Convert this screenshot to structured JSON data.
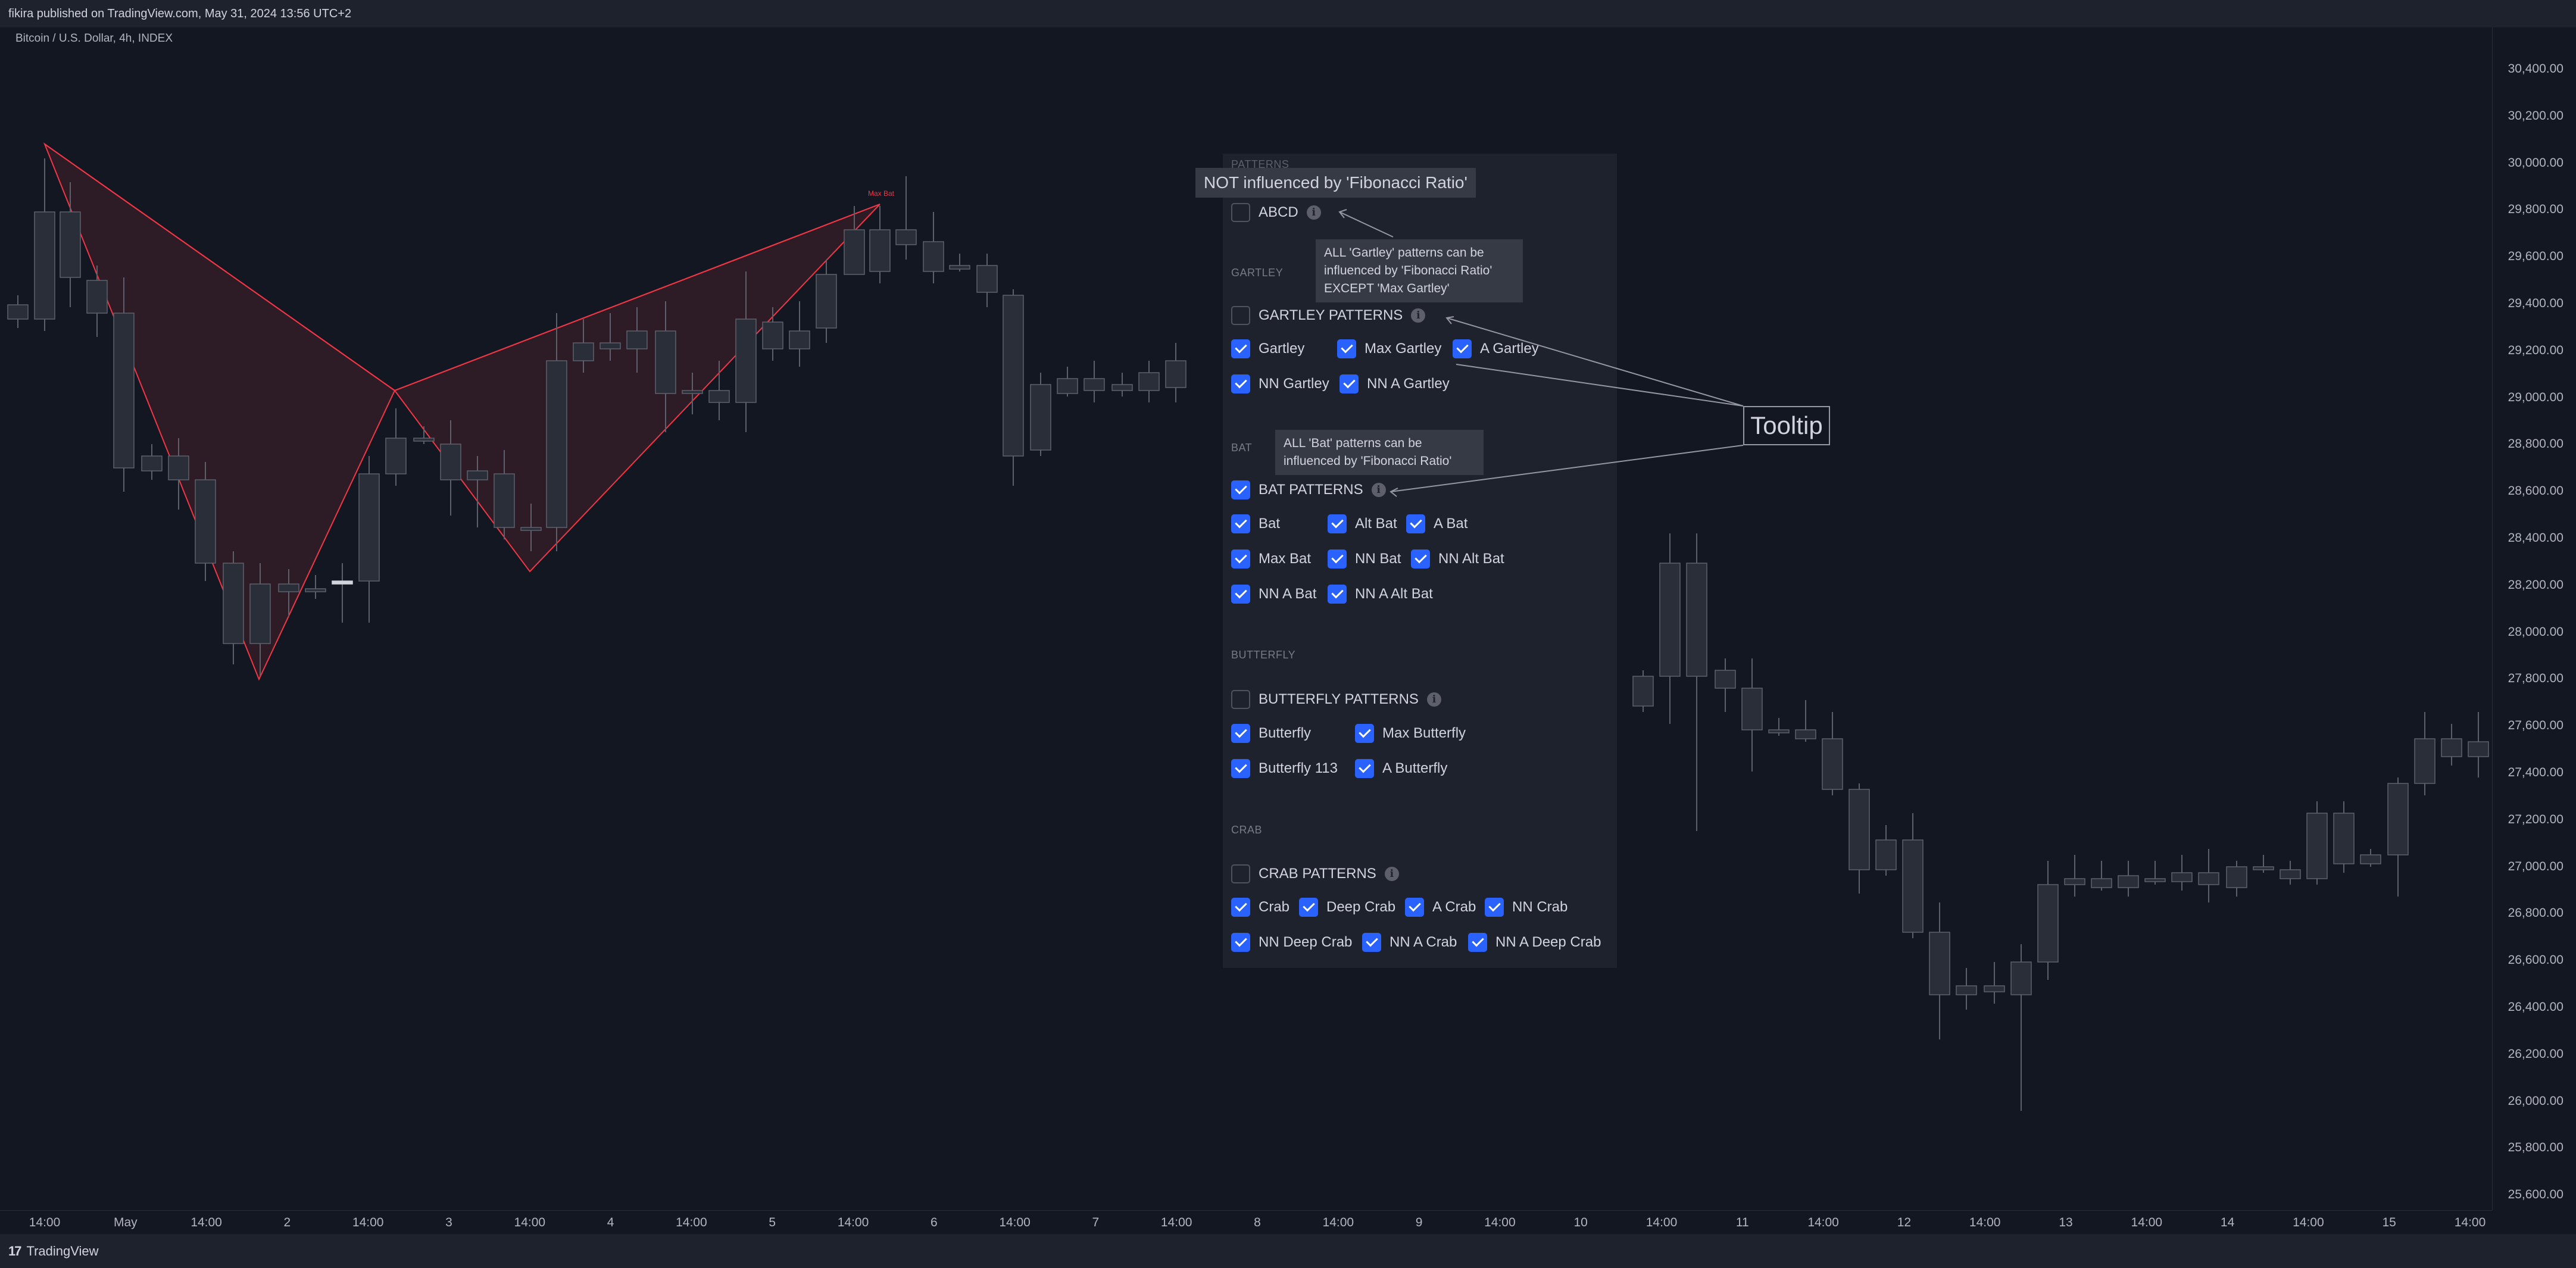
{
  "header": {
    "published": "fikira published on TradingView.com, May 31, 2024 13:56 UTC+2"
  },
  "chart": {
    "symbol": "Bitcoin / U.S. Dollar, 4h, INDEX",
    "pattern_label": "Max Bat",
    "price_axis": [
      "30,400.00",
      "30,200.00",
      "30,000.00",
      "29,800.00",
      "29,600.00",
      "29,400.00",
      "29,200.00",
      "29,000.00",
      "28,800.00",
      "28,600.00",
      "28,400.00",
      "28,200.00",
      "28,000.00",
      "27,800.00",
      "27,600.00",
      "27,400.00",
      "27,200.00",
      "27,000.00",
      "26,800.00",
      "26,600.00",
      "26,400.00",
      "26,200.00",
      "26,000.00",
      "25,800.00",
      "25,600.00"
    ],
    "time_axis": [
      "14:00",
      "May",
      "14:00",
      "2",
      "14:00",
      "3",
      "14:00",
      "4",
      "14:00",
      "5",
      "14:00",
      "6",
      "14:00",
      "7",
      "14:00",
      "8",
      "14:00",
      "9",
      "14:00",
      "10",
      "14:00",
      "11",
      "14:00",
      "12",
      "14:00",
      "13",
      "14:00",
      "14",
      "14:00",
      "15",
      "14:00"
    ],
    "colors": {
      "bull": "#d1d4dc",
      "bear": "#2a2e39",
      "wick": "#5d606b",
      "pattern": "#f23645"
    }
  },
  "panel": {
    "partial_header": "PATTERNS",
    "abcd": {
      "label": "ABCD",
      "checked": false
    },
    "gartley": {
      "section": "GARTLEY",
      "header": {
        "label": "GARTLEY PATTERNS",
        "checked": false
      },
      "options": [
        {
          "label": "Gartley",
          "checked": true
        },
        {
          "label": "Max Gartley",
          "checked": true
        },
        {
          "label": "A Gartley",
          "checked": true
        },
        {
          "label": "NN Gartley",
          "checked": true
        },
        {
          "label": "NN A Gartley",
          "checked": true
        }
      ]
    },
    "bat": {
      "section": "BAT",
      "header": {
        "label": "BAT PATTERNS",
        "checked": true
      },
      "options": [
        {
          "label": "Bat",
          "checked": true
        },
        {
          "label": "Alt Bat",
          "checked": true
        },
        {
          "label": "A Bat",
          "checked": true
        },
        {
          "label": "Max Bat",
          "checked": true
        },
        {
          "label": "NN Bat",
          "checked": true
        },
        {
          "label": "NN Alt Bat",
          "checked": true
        },
        {
          "label": "NN A Bat",
          "checked": true
        },
        {
          "label": "NN A Alt Bat",
          "checked": true
        }
      ]
    },
    "butterfly": {
      "section": "BUTTERFLY",
      "header": {
        "label": "BUTTERFLY PATTERNS",
        "checked": false
      },
      "options": [
        {
          "label": "Butterfly",
          "checked": true
        },
        {
          "label": "Max Butterfly",
          "checked": true
        },
        {
          "label": "Butterfly 113",
          "checked": true
        },
        {
          "label": "A Butterfly",
          "checked": true
        }
      ]
    },
    "crab": {
      "section": "CRAB",
      "header": {
        "label": "CRAB PATTERNS",
        "checked": false
      },
      "options": [
        {
          "label": "Crab",
          "checked": true
        },
        {
          "label": "Deep Crab",
          "checked": true
        },
        {
          "label": "A Crab",
          "checked": true
        },
        {
          "label": "NN Crab",
          "checked": true
        },
        {
          "label": "NN Deep Crab",
          "checked": true
        },
        {
          "label": "NN A Crab",
          "checked": true
        },
        {
          "label": "NN A Deep Crab",
          "checked": true
        }
      ]
    }
  },
  "tooltips": {
    "abcd": "NOT influenced by 'Fibonacci Ratio'",
    "gartley": [
      "ALL 'Gartley' patterns can be",
      "influenced by 'Fibonacci Ratio'",
      "EXCEPT 'Max Gartley'"
    ],
    "bat": [
      "ALL 'Bat' patterns can be",
      "influenced by 'Fibonacci Ratio'"
    ],
    "callout": "Tooltip"
  },
  "footer": {
    "brand": "TradingView",
    "logo": "tradingview-logo"
  }
}
